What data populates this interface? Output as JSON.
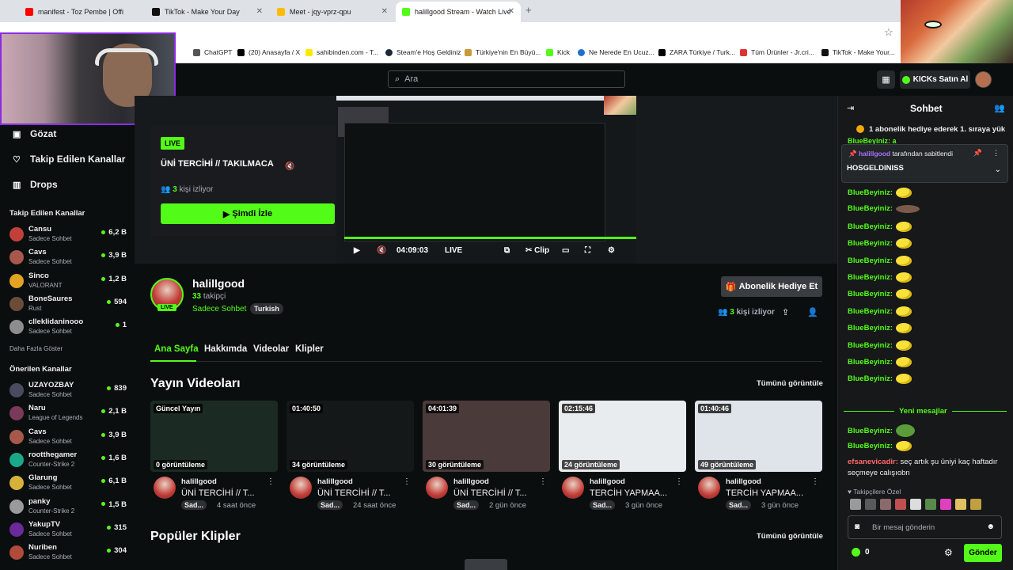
{
  "browser": {
    "tabs": [
      {
        "label": "manifest - Toz Pembe | Offi",
        "fav": "#ff0000"
      },
      {
        "label": "TikTok - Make Your Day",
        "fav": "#111111"
      },
      {
        "label": "Meet - jqy-vprz-qpu",
        "fav": "#fbbc04"
      },
      {
        "label": "halillgood Stream - Watch Live",
        "fav": "#53fc18"
      }
    ],
    "bookmarks": [
      "ChatGPT",
      "(20) Anasayfa / X",
      "sahibinden.com - T...",
      "Steam'e Hoş Geldiniz",
      "Türkiye'nin En Büyü...",
      "Kick",
      "Ne Nerede En Ucuz...",
      "ZARA Türkiye / Turk...",
      "Tüm Ürünler - Jr.cri...",
      "TikTok - Make Your..."
    ]
  },
  "topnav": {
    "search_placeholder": "Ara",
    "kicks_label": "KICKs Satın Al"
  },
  "sidebar": {
    "nav": [
      {
        "icon": "browse-icon",
        "label": "Gözat"
      },
      {
        "icon": "heart-icon",
        "label": "Takip Edilen Kanallar"
      },
      {
        "icon": "drops-icon",
        "label": "Drops"
      }
    ],
    "followed_title": "Takip Edilen Kanallar",
    "followed": [
      {
        "name": "Cansu",
        "sub": "Sadece Sohbet",
        "viewers": "6,2 B",
        "color": "#c2403a"
      },
      {
        "name": "Cavs",
        "sub": "Sadece Sohbet",
        "viewers": "3,9 B",
        "color": "#a8574b"
      },
      {
        "name": "Sinco",
        "sub": "VALORANT",
        "viewers": "1,2 B",
        "color": "#e1a321"
      },
      {
        "name": "BoneSaures",
        "sub": "Rust",
        "viewers": "594",
        "color": "#6b4b3a"
      },
      {
        "name": "clleklidaninooo",
        "sub": "Sadece Sohbet",
        "viewers": "1",
        "color": "#8d8d8d"
      }
    ],
    "more_label": "Daha Fazla Göster",
    "recommended_title": "Önerilen Kanallar",
    "recommended": [
      {
        "name": "UZAYOZBAY",
        "sub": "Sadece Sohbet",
        "viewers": "839",
        "color": "#4a4a60"
      },
      {
        "name": "Naru",
        "sub": "League of Legends",
        "viewers": "2,1 B",
        "color": "#7a3a5a"
      },
      {
        "name": "Cavs",
        "sub": "Sadece Sohbet",
        "viewers": "3,9 B",
        "color": "#a8574b"
      },
      {
        "name": "rootthegamer",
        "sub": "Counter-Strike 2",
        "viewers": "1,6 B",
        "color": "#1aa88a"
      },
      {
        "name": "Glarung",
        "sub": "Sadece Sohbet",
        "viewers": "6,1 B",
        "color": "#d6b23a"
      },
      {
        "name": "panky",
        "sub": "Counter-Strike 2",
        "viewers": "1,5 B",
        "color": "#9a9a9a"
      },
      {
        "name": "YakupTV",
        "sub": "Sadece Sohbet",
        "viewers": "315",
        "color": "#6a2a9a"
      },
      {
        "name": "Nuriben",
        "sub": "Sadece Sohbet",
        "viewers": "304",
        "color": "#b04a3a"
      }
    ]
  },
  "player": {
    "live": "LIVE",
    "title": "ÜNİ TERCİHİ // TAKILMACA",
    "viewers_count": "3",
    "viewers_label": "kişi izliyor",
    "watch_label": "Şimdi İzle",
    "time": "04:09:03",
    "live_ctrl": "LIVE",
    "clip_label": "Clip"
  },
  "channel": {
    "name": "halillgood",
    "followers_count": "33",
    "followers_label": "takipçi",
    "category": "Sadece Sohbet",
    "tag": "Turkish",
    "live": "LIVE",
    "gift_label": "Abonelik Hediye Et",
    "viewers_count": "3",
    "viewers_label": "kişi izliyor"
  },
  "tabs": [
    "Ana Sayfa",
    "Hakkımda",
    "Videolar",
    "Klipler"
  ],
  "videos_section": {
    "title": "Yayın Videoları",
    "see_all": "Tümünü görüntüle"
  },
  "videos": [
    {
      "badge": "Güncel Yayın",
      "views": "0 görüntüleme",
      "channel": "halillgood",
      "title": "ÜNİ TERCİHİ // T...",
      "cat": "Sad...",
      "ago": "4 saat önce",
      "bg": "#1b2a22"
    },
    {
      "badge": "01:40:50",
      "views": "34 görüntüleme",
      "channel": "halillgood",
      "title": "ÜNİ TERCİHİ // T...",
      "cat": "Sad...",
      "ago": "24 saat önce",
      "bg": "#141819"
    },
    {
      "badge": "04:01:39",
      "views": "30 görüntüleme",
      "channel": "halillgood",
      "title": "ÜNİ TERCİHİ // T...",
      "cat": "Sad...",
      "ago": "2 gün önce",
      "bg": "#4a3a3a"
    },
    {
      "badge": "02:15:46",
      "views": "24 görüntüleme",
      "channel": "halillgood",
      "title": "TERCİH YAPMAA...",
      "cat": "Sad...",
      "ago": "3 gün önce",
      "bg": "#e9ecef"
    },
    {
      "badge": "01:40:46",
      "views": "49 görüntüleme",
      "channel": "halillgood",
      "title": "TERCİH YAPMAA...",
      "cat": "Sad...",
      "ago": "3 gün önce",
      "bg": "#dfe4ea"
    }
  ],
  "clips_section": {
    "title": "Popüler Klipler",
    "see_all": "Tümünü görüntüle"
  },
  "chat": {
    "title": "Sohbet",
    "subgoal": "1 abonelik hediye ederek 1. sıraya yük",
    "peek": "BlueBeyiniz: a",
    "pinned_by": "halillgood",
    "pinned_suffix": "tarafından sabitlendi",
    "pinned_msg": "HOSGELDINISS",
    "messages": [
      {
        "user": "BlueBeyiniz:",
        "emo": "yellow"
      },
      {
        "user": "BlueBeyiniz:",
        "emo": "dark"
      },
      {
        "user": "BlueBeyiniz:",
        "emo": "yellow"
      },
      {
        "user": "BlueBeyiniz:",
        "emo": "yellow"
      },
      {
        "user": "BlueBeyiniz:",
        "emo": "yellow"
      },
      {
        "user": "BlueBeyiniz:",
        "emo": "yellow"
      },
      {
        "user": "BlueBeyiniz:",
        "emo": "yellow"
      },
      {
        "user": "BlueBeyiniz:",
        "emo": "yellow"
      },
      {
        "user": "BlueBeyiniz:",
        "emo": "yellow"
      },
      {
        "user": "BlueBeyiniz:",
        "emo": "yellow"
      },
      {
        "user": "BlueBeyiniz:",
        "emo": "yellow"
      },
      {
        "user": "BlueBeyiniz:",
        "emo": "yellow"
      }
    ],
    "new_messages": "Yeni mesajlar",
    "after": [
      {
        "user": "BlueBeyiniz:",
        "emo": "frog"
      },
      {
        "user": "BlueBeyiniz:",
        "emo": "yellow"
      }
    ],
    "efsa_user": "efsanevicadir:",
    "efsa_text": "seç artık şu üniyi kaç haftadır seçmeye calışıobn",
    "follower_label": "Takipçilere Özel",
    "input_placeholder": "Bir mesaj gönderin",
    "kicks": "0",
    "send": "Gönder"
  },
  "colors": {
    "accent": "#53fc18",
    "bg": "#0b0e0f"
  }
}
